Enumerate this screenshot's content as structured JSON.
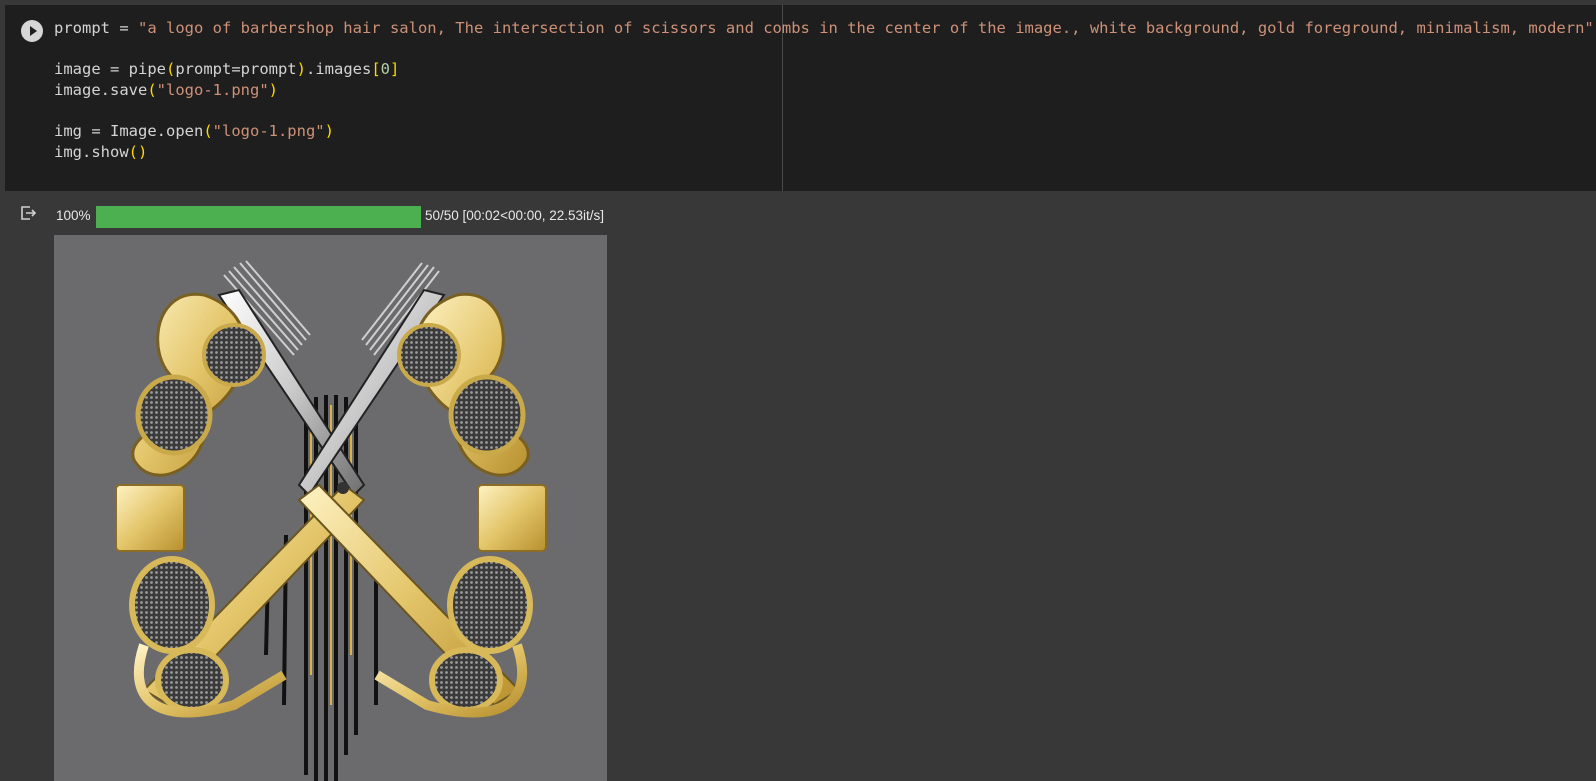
{
  "cell": {
    "code_lines": [
      [
        {
          "t": "prompt = ",
          "c": ""
        },
        {
          "t": "\"a logo of barbershop hair salon, The intersection of scissors and combs in the center of the image., white background, gold foreground, minimalism, modern\"",
          "c": "str"
        }
      ],
      [],
      [
        {
          "t": "image = pipe",
          "c": ""
        },
        {
          "t": "(",
          "c": "par"
        },
        {
          "t": "prompt=prompt",
          "c": ""
        },
        {
          "t": ")",
          "c": "par"
        },
        {
          "t": ".images",
          "c": ""
        },
        {
          "t": "[",
          "c": "par"
        },
        {
          "t": "0",
          "c": "num"
        },
        {
          "t": "]",
          "c": "par"
        }
      ],
      [
        {
          "t": "image.save",
          "c": ""
        },
        {
          "t": "(",
          "c": "par"
        },
        {
          "t": "\"logo-1.png\"",
          "c": "str"
        },
        {
          "t": ")",
          "c": "par"
        }
      ],
      [],
      [
        {
          "t": "img = Image.open",
          "c": ""
        },
        {
          "t": "(",
          "c": "par"
        },
        {
          "t": "\"logo-1.png\"",
          "c": "str"
        },
        {
          "t": ")",
          "c": "par"
        }
      ],
      [
        {
          "t": "img.show",
          "c": ""
        },
        {
          "t": "()",
          "c": "par"
        }
      ]
    ]
  },
  "output": {
    "progress_percent_label": "100%",
    "progress_fraction": 1.0,
    "progress_text": "50/50 [00:02<00:00, 22.53it/s]"
  },
  "colors": {
    "bg": "#383838",
    "code_bg": "#1e1e1e",
    "string": "#ce9178",
    "number": "#b5cea8",
    "bracket": "#ffd700",
    "progress": "#4caf50",
    "gold": "#e8cf7a"
  },
  "icons": {
    "run": "play-circle-icon",
    "output": "output-arrow-icon"
  }
}
